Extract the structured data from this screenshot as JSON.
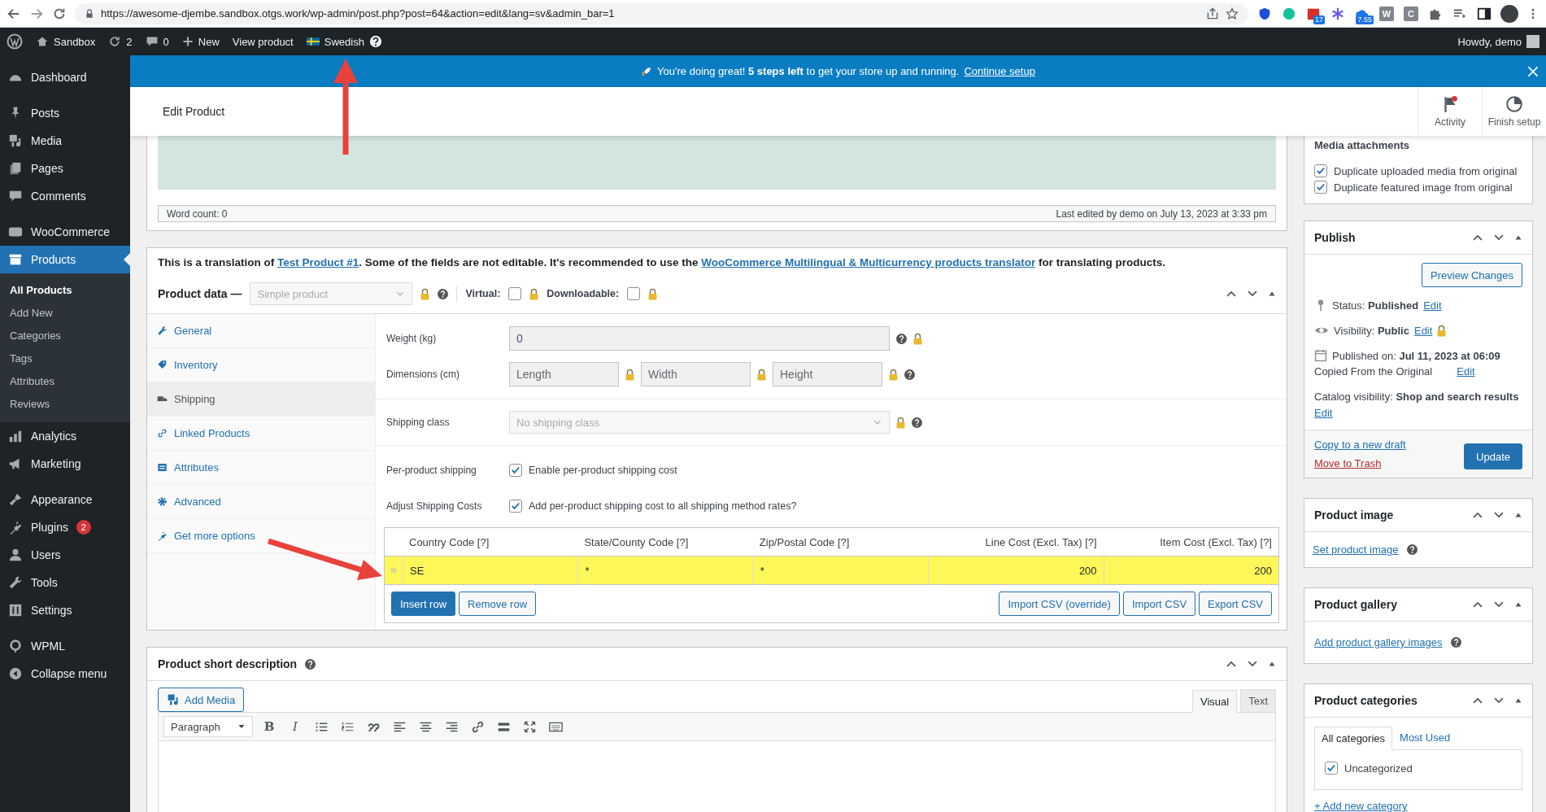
{
  "browser": {
    "url": "https://awesome-djembe.sandbox.otgs.work/wp-admin/post.php?post=64&action=edit&lang=sv&admin_bar=1",
    "extensions": [
      {
        "kind": "shield"
      },
      {
        "kind": "grammar"
      },
      {
        "kind": "calendar",
        "badge": "17"
      },
      {
        "kind": "snowflake"
      },
      {
        "kind": "cloud",
        "badge": "7.55"
      },
      {
        "kind": "letter",
        "label": "W"
      },
      {
        "kind": "letter",
        "label": "C"
      },
      {
        "kind": "puzzle"
      },
      {
        "kind": "playlist"
      },
      {
        "kind": "sidebar"
      }
    ]
  },
  "admin_bar": {
    "site": "Sandbox",
    "updates": "2",
    "comments": "0",
    "new": "New",
    "view": "View product",
    "language": "Swedish",
    "howdy": "Howdy, demo"
  },
  "sidebar": {
    "groups": [
      {
        "items": [
          {
            "label": "Dashboard",
            "selected": false
          }
        ]
      },
      {
        "items": [
          {
            "label": "Posts",
            "selected": false
          },
          {
            "label": "Media",
            "selected": false
          },
          {
            "label": "Pages",
            "selected": false
          },
          {
            "label": "Comments",
            "selected": false
          }
        ]
      },
      {
        "items": [
          {
            "label": "WooCommerce",
            "selected": false
          },
          {
            "label": "Products",
            "selected": true,
            "expanded": true,
            "children": [
              {
                "label": "All Products",
                "selected": true
              },
              {
                "label": "Add New",
                "selected": false
              },
              {
                "label": "Categories",
                "selected": false
              },
              {
                "label": "Tags",
                "selected": false
              },
              {
                "label": "Attributes",
                "selected": false
              },
              {
                "label": "Reviews",
                "selected": false
              }
            ]
          },
          {
            "label": "Analytics",
            "selected": false
          },
          {
            "label": "Marketing",
            "selected": false
          }
        ]
      },
      {
        "items": [
          {
            "label": "Appearance",
            "selected": false
          },
          {
            "label": "Plugins",
            "selected": false,
            "badge": "2"
          },
          {
            "label": "Users",
            "selected": false
          },
          {
            "label": "Tools",
            "selected": false
          },
          {
            "label": "Settings",
            "selected": false
          }
        ]
      },
      {
        "items": [
          {
            "label": "WPML",
            "selected": false
          },
          {
            "label": "Collapse menu",
            "selected": false
          }
        ]
      }
    ]
  },
  "notice": {
    "text": "You're doing great! **5 steps left** to get your store up and running.",
    "link": "Continue setup"
  },
  "header": {
    "title": "Edit Product",
    "actions": [
      {
        "label": "Activity"
      },
      {
        "label": "Finish setup"
      }
    ]
  },
  "editor_footer": {
    "word_count": "Word count: 0",
    "last_edited": "Last edited by demo on July 13, 2023 at 3:33 pm"
  },
  "product_data": {
    "notice": {
      "before": "This is a translation of ",
      "link": "Test Product #1",
      "middle": ". Some of the fields are not editable. It's recommended to use the ",
      "link2": "WooCommerce Multilingual & Multicurrency products translator",
      "after": " for translating products."
    },
    "title": "Product data —",
    "type_select": {
      "value": "Simple product",
      "disabled": true
    },
    "virtual": {
      "label": "Virtual:",
      "checked": false
    },
    "downloadable": {
      "label": "Downloadable:",
      "checked": false
    },
    "tabs": [
      {
        "label": "General",
        "selected": false
      },
      {
        "label": "Inventory",
        "selected": false
      },
      {
        "label": "Shipping",
        "selected": true
      },
      {
        "label": "Linked Products",
        "selected": false
      },
      {
        "label": "Attributes",
        "selected": false
      },
      {
        "label": "Advanced",
        "selected": false
      },
      {
        "label": "Get more options",
        "selected": false
      }
    ],
    "weight": {
      "label": "Weight (kg)",
      "value": "0"
    },
    "dimensions": {
      "label": "Dimensions (cm)",
      "placeholders": [
        "Length",
        "Width",
        "Height"
      ]
    },
    "shipping_class": {
      "label": "Shipping class",
      "value": "No shipping class"
    },
    "per_product": {
      "label": "Per-product shipping",
      "checkbox_label": "Enable per-product shipping cost",
      "checked": true
    },
    "adjust": {
      "label": "Adjust Shipping Costs",
      "checkbox_label": "Add per-product shipping cost to all shipping method rates?",
      "checked": true
    },
    "cost_table": {
      "columns": [
        "Country Code [?]",
        "State/County Code [?]",
        "Zip/Postal Code [?]",
        "Line Cost (Excl. Tax) [?]",
        "Item Cost (Excl. Tax) [?]"
      ],
      "rows": [
        {
          "cells": [
            "SE",
            "*",
            "*",
            "200",
            "200"
          ],
          "selected": true
        }
      ],
      "left_buttons": [
        {
          "label": "Insert row",
          "primary": true
        },
        {
          "label": "Remove row",
          "primary": false
        }
      ],
      "right_buttons": [
        "Import CSV (override)",
        "Import CSV",
        "Export CSV"
      ]
    }
  },
  "short_description": {
    "title": "Product short description",
    "add_media": "Add Media",
    "tabs": [
      {
        "label": "Visual",
        "selected": true
      },
      {
        "label": "Text",
        "selected": false
      }
    ],
    "format": "Paragraph",
    "toolbar": [
      {
        "kind": "bold",
        "label": "B"
      },
      {
        "kind": "italic",
        "label": "I"
      },
      {
        "kind": "bullets"
      },
      {
        "kind": "numbers"
      },
      {
        "kind": "quote"
      },
      {
        "kind": "align-left"
      },
      {
        "kind": "align-center"
      },
      {
        "kind": "align-right"
      },
      {
        "kind": "link"
      },
      {
        "kind": "more"
      },
      {
        "kind": "fullscreen"
      },
      {
        "kind": "keyboard"
      }
    ]
  },
  "media_attachments": {
    "title": "Media attachments",
    "options": [
      {
        "label": "Duplicate uploaded media from original",
        "checked": true
      },
      {
        "label": "Duplicate featured image from original",
        "checked": true
      }
    ]
  },
  "publish": {
    "title": "Publish",
    "preview": "Preview Changes",
    "status": "Status: **Published**",
    "visibility": "Visibility: **Public**",
    "published_on": "Published on: **Jul 11, 2023 at 06:09**",
    "copied": "Copied From the Original",
    "catalog": "Catalog visibility: **Shop and search results**",
    "status_edit": "Edit",
    "visibility_edit": "Edit",
    "copied_edit": "Edit",
    "catalog_edit": "Edit",
    "copy_draft": "Copy to a new draft",
    "trash": "Move to Trash",
    "update": "Update"
  },
  "product_image": {
    "title": "Product image",
    "link": "Set product image"
  },
  "product_gallery": {
    "title": "Product gallery",
    "link": "Add product gallery images"
  },
  "product_categories": {
    "title": "Product categories",
    "tabs": [
      {
        "label": "All categories",
        "selected": true
      },
      {
        "label": "Most Used",
        "selected": false
      }
    ],
    "items": [
      {
        "label": "Uncategorized",
        "checked": true
      }
    ],
    "add": "+ Add new category"
  }
}
